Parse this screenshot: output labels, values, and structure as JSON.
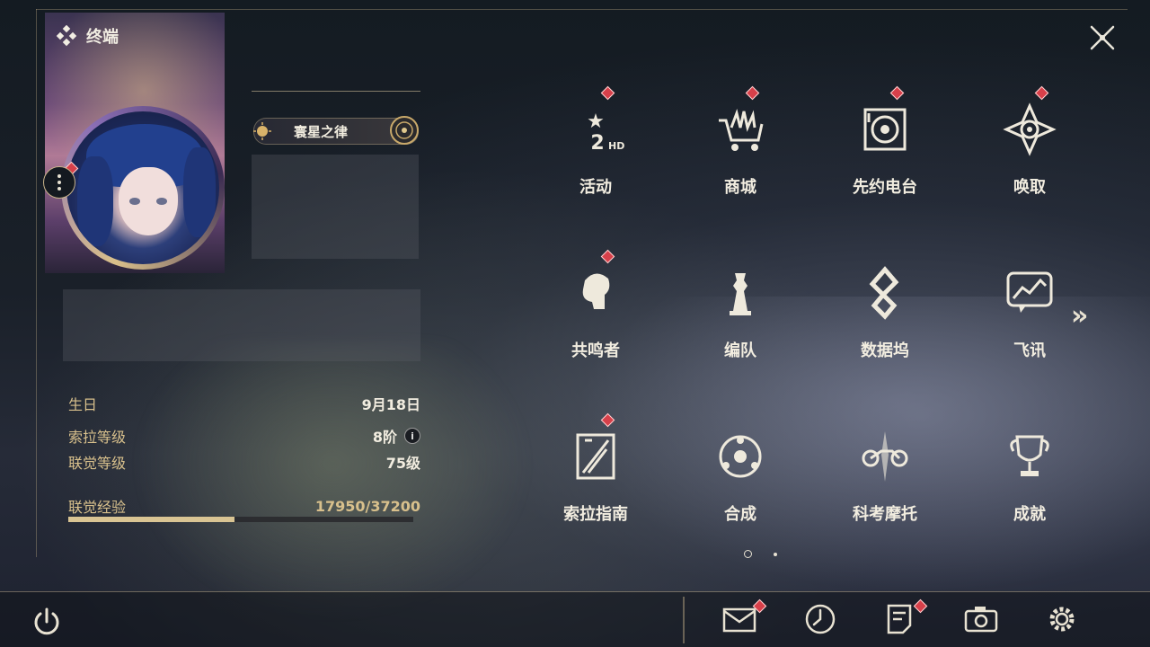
{
  "header": {
    "title": "终端"
  },
  "profile": {
    "name": "寰星之律",
    "birthday_label": "生日",
    "birthday_value": "9月18日",
    "sola_level_label": "索拉等级",
    "sola_level_value": "8阶",
    "union_level_label": "联觉等级",
    "union_level_value": "75级",
    "union_exp_label": "联觉经验",
    "union_exp_value": "17950/37200",
    "union_exp_progress": 0.4825,
    "info_icon": "i"
  },
  "menu": {
    "items": [
      {
        "label": "活动",
        "icon": "events-icon",
        "notify": true
      },
      {
        "label": "商城",
        "icon": "shop-icon",
        "notify": true
      },
      {
        "label": "先约电台",
        "icon": "radio-icon",
        "notify": true
      },
      {
        "label": "唤取",
        "icon": "convene-icon",
        "notify": true
      },
      {
        "label": "共鸣者",
        "icon": "resonator-icon",
        "notify": true
      },
      {
        "label": "编队",
        "icon": "team-icon",
        "notify": false
      },
      {
        "label": "数据坞",
        "icon": "databank-icon",
        "notify": false
      },
      {
        "label": "飞讯",
        "icon": "chat-icon",
        "notify": false
      },
      {
        "label": "索拉指南",
        "icon": "guidebook-icon",
        "notify": true
      },
      {
        "label": "合成",
        "icon": "synthesis-icon",
        "notify": false
      },
      {
        "label": "科考摩托",
        "icon": "motorbike-icon",
        "notify": false
      },
      {
        "label": "成就",
        "icon": "trophy-icon",
        "notify": false
      }
    ],
    "next_page_glyph": "»",
    "page_count": 2,
    "current_page": 1
  },
  "bottom_bar": {
    "icons": [
      "power-icon",
      "mail-icon",
      "clock-icon",
      "notice-icon",
      "camera-icon",
      "settings-icon"
    ]
  },
  "colors": {
    "accent_gold": "#d9c493",
    "notify_red": "#d7404a",
    "text_light": "#f2ede0"
  }
}
